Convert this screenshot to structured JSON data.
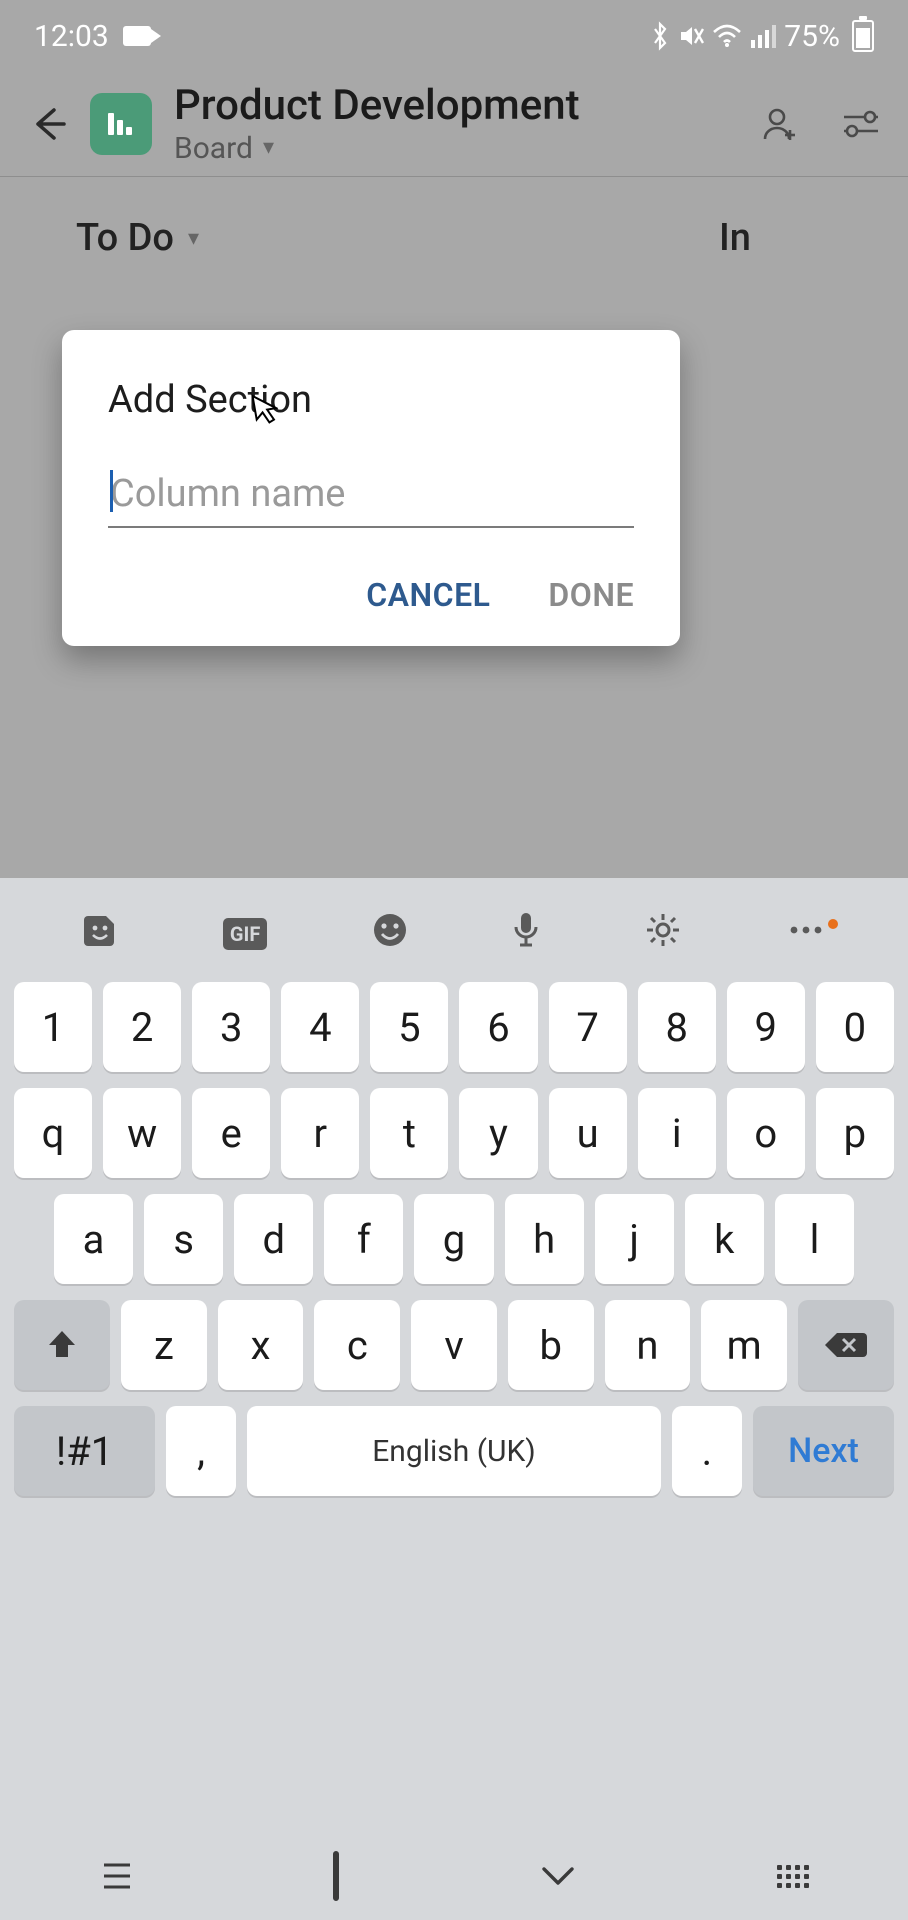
{
  "status": {
    "time": "12:03",
    "battery_pct": "75%"
  },
  "header": {
    "title": "Product Development",
    "view": "Board"
  },
  "board": {
    "col0": "To Do",
    "col1": "In"
  },
  "modal": {
    "title": "Add Section",
    "placeholder": "Column name",
    "cancel": "CANCEL",
    "done": "DONE"
  },
  "keyboard": {
    "row_num": [
      "1",
      "2",
      "3",
      "4",
      "5",
      "6",
      "7",
      "8",
      "9",
      "0"
    ],
    "row_top": [
      "q",
      "w",
      "e",
      "r",
      "t",
      "y",
      "u",
      "i",
      "o",
      "p"
    ],
    "row_mid": [
      "a",
      "s",
      "d",
      "f",
      "g",
      "h",
      "j",
      "k",
      "l"
    ],
    "row_bot": [
      "z",
      "x",
      "c",
      "v",
      "b",
      "n",
      "m"
    ],
    "sym": "!#1",
    "comma": ",",
    "space_label": "English (UK)",
    "period": ".",
    "next": "Next"
  }
}
